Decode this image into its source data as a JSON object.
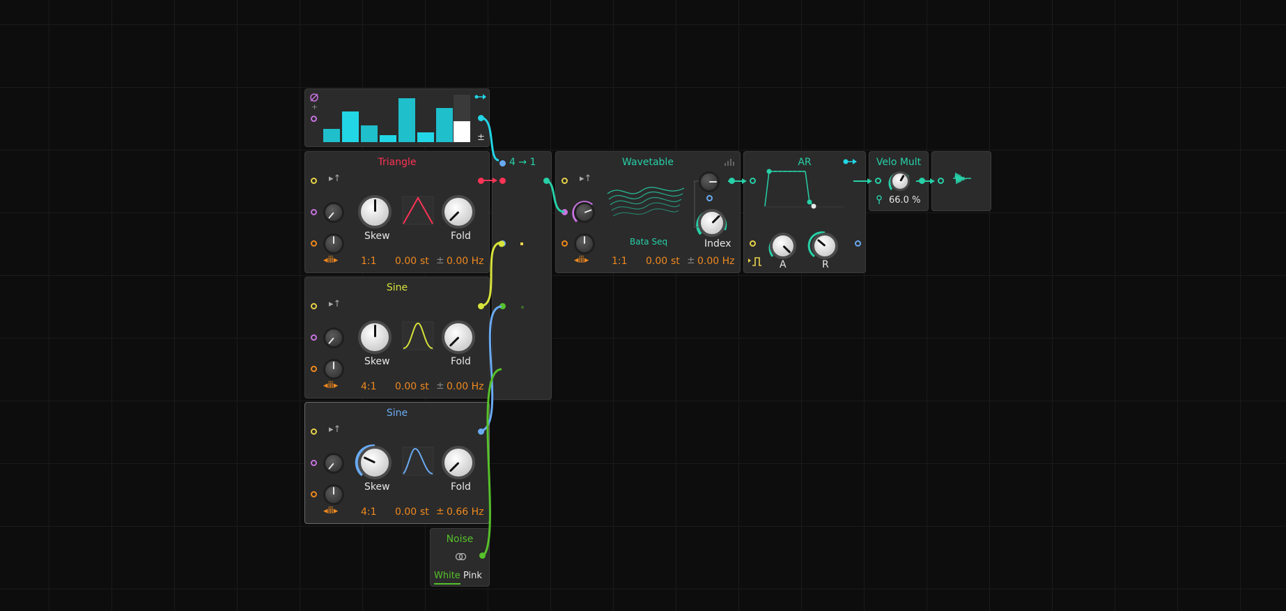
{
  "colors": {
    "triangle": "#ff3355",
    "sine_yellow": "#d7e43a",
    "sine_blue": "#6aaaf2",
    "noise_green": "#56c12a",
    "teal": "#27d1a8",
    "cyan": "#22d6e6",
    "orange": "#f0891e",
    "purple": "#c873e0",
    "yellow_port": "#e8d34a"
  },
  "steps": {
    "values": [
      0.28,
      0.65,
      0.36,
      0.15,
      0.92,
      0.2,
      0.72,
      0.42
    ]
  },
  "selector": {
    "title": "4 → 1"
  },
  "triangle": {
    "title": "Triangle",
    "skew_label": "Skew",
    "fold_label": "Fold",
    "ratio": "1:1",
    "semitones": "0.00",
    "st_unit": "st",
    "pm": "±",
    "hz": "0.00 Hz"
  },
  "sine1": {
    "title": "Sine",
    "skew_label": "Skew",
    "fold_label": "Fold",
    "ratio": "4:1",
    "semitones": "0.00",
    "st_unit": "st",
    "pm": "±",
    "hz": "0.00 Hz"
  },
  "sine2": {
    "title": "Sine",
    "skew_label": "Skew",
    "fold_label": "Fold",
    "ratio": "4:1",
    "semitones": "0.00",
    "st_unit": "st",
    "pm": "±",
    "hz": "0.66 Hz"
  },
  "noise": {
    "title": "Noise",
    "white": "White",
    "pink": "Pink",
    "selected": "White"
  },
  "wavetable": {
    "title": "Wavetable",
    "table_name": "Bata Seq",
    "index_label": "Index",
    "ratio": "1:1",
    "semitones": "0.00",
    "st_unit": "st",
    "pm": "±",
    "hz": "0.00 Hz"
  },
  "ar": {
    "title": "AR",
    "a_label": "A",
    "r_label": "R"
  },
  "velo": {
    "title": "Velo Mult",
    "value": "66.0 %",
    "amount": 0.66
  }
}
